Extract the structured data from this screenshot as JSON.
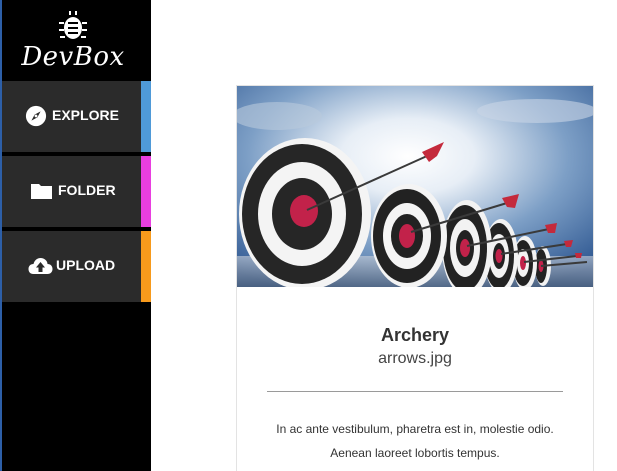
{
  "brand": {
    "logo_text": "DevBox",
    "logo_icon": "bug-icon"
  },
  "sidebar": {
    "items": [
      {
        "label": "EXPLORE",
        "icon": "compass-icon",
        "accent": "#4f9ad8"
      },
      {
        "label": "FOLDER",
        "icon": "folder-icon",
        "accent": "#e93ee0"
      },
      {
        "label": "UPLOAD",
        "icon": "cloud-upload-icon",
        "accent": "#f79a1c"
      }
    ]
  },
  "card": {
    "title": "Archery",
    "subtitle": "arrows.jpg",
    "description": "In ac ante vestibulum, pharetra est in, molestie odio. Aenean laoreet lobortis tempus."
  }
}
